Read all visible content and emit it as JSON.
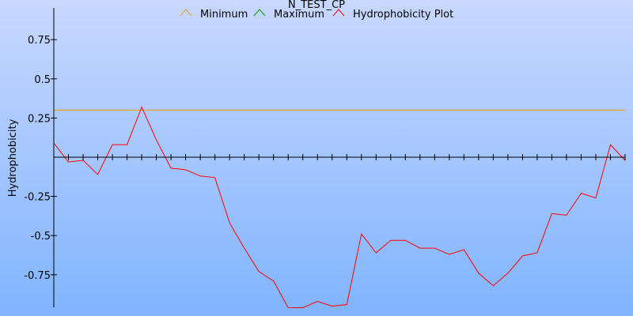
{
  "chart_data": {
    "type": "line",
    "title": "N_TEST_CP",
    "ylabel": "Hydrophobicity",
    "xlabel": "",
    "ylim": [
      -0.96,
      0.94
    ],
    "xlim": [
      0,
      39
    ],
    "yticks": [
      {
        "value": 0.75,
        "label": "0.75"
      },
      {
        "value": 0.5,
        "label": "0.5"
      },
      {
        "value": 0.25,
        "label": "0.25"
      },
      {
        "value": -0.25,
        "label": "-0.25"
      },
      {
        "value": -0.5,
        "label": "-0.5"
      },
      {
        "value": -0.75,
        "label": "-0.75"
      }
    ],
    "legend": {
      "placement": "top",
      "entries": [
        {
          "name": "Minimum",
          "color": "#e8a020"
        },
        {
          "name": "Maximum",
          "color": "#00a000"
        },
        {
          "name": "Hydrophobicity Plot",
          "color": "#ff0000"
        }
      ]
    },
    "series": [
      {
        "name": "Minimum",
        "color": "#e8a020",
        "type": "hline",
        "y": 0.3
      },
      {
        "name": "Maximum",
        "color": "#00a000",
        "type": "hline",
        "y": null
      },
      {
        "name": "Hydrophobicity Plot",
        "color": "#ff0000",
        "x": [
          0,
          1,
          2,
          3,
          4,
          5,
          6,
          7,
          8,
          9,
          10,
          11,
          12,
          13,
          14,
          15,
          16,
          17,
          18,
          19,
          20,
          21,
          22,
          23,
          24,
          25,
          26,
          27,
          28,
          29,
          30,
          31,
          32,
          33,
          34,
          35,
          36,
          37,
          38,
          39
        ],
        "values": [
          0.09,
          -0.03,
          -0.02,
          -0.11,
          0.08,
          0.08,
          0.32,
          0.11,
          -0.07,
          -0.08,
          -0.12,
          -0.13,
          -0.42,
          -0.58,
          -0.73,
          -0.79,
          -0.96,
          -0.96,
          -0.92,
          -0.95,
          -0.94,
          -0.49,
          -0.61,
          -0.53,
          -0.53,
          -0.58,
          -0.58,
          -0.62,
          -0.59,
          -0.74,
          -0.82,
          -0.74,
          -0.63,
          -0.61,
          -0.36,
          -0.37,
          -0.23,
          -0.26,
          0.08,
          -0.02
        ]
      }
    ],
    "grid": false,
    "background": {
      "top": "#c8d8ff",
      "bottom": "#80b4ff"
    }
  }
}
